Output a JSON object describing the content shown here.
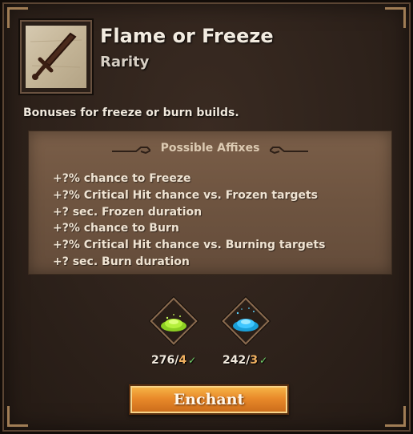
{
  "item": {
    "title": "Flame or Freeze",
    "rarity": "Rarity",
    "description": "Bonuses for freeze or burn builds.",
    "icon": "sword-icon"
  },
  "affixes": {
    "header": "Possible Affixes",
    "items": [
      "+?% chance to Freeze",
      "+?% Critical Hit chance vs. Frozen targets",
      "+? sec. Frozen duration",
      "+?% chance to Burn",
      "+?% Critical Hit chance vs. Burning targets",
      "+? sec. Burn duration"
    ]
  },
  "materials": [
    {
      "name": "green-dust-icon",
      "have": "276",
      "need": "4",
      "color": "#a6e22e"
    },
    {
      "name": "blue-dust-icon",
      "have": "242",
      "need": "3",
      "color": "#3fc6ff"
    }
  ],
  "enchant_label": "Enchant",
  "colors": {
    "panel_bg": "#2e221b",
    "affix_bg": "#6e5440",
    "button": "#e98a2a",
    "need_text": "#f0b060",
    "check": "#6fd36a"
  }
}
